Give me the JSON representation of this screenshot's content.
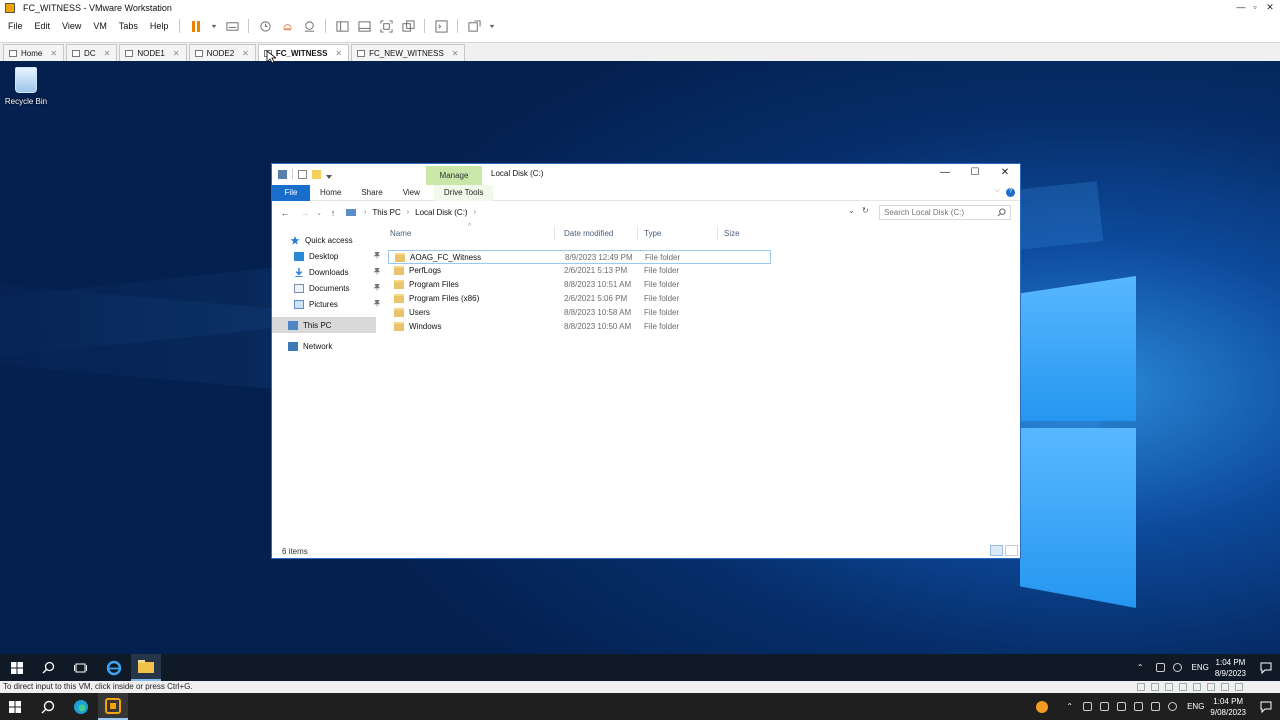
{
  "host_window": {
    "title": "FC_WITNESS - VMware Workstation",
    "menu": [
      "File",
      "Edit",
      "View",
      "VM",
      "Tabs",
      "Help"
    ],
    "window_controls": [
      "—",
      "▫",
      "✕"
    ]
  },
  "vm_tabs": [
    {
      "label": "Home",
      "active": false
    },
    {
      "label": "DC",
      "active": false
    },
    {
      "label": "NODE1",
      "active": false
    },
    {
      "label": "NODE2",
      "active": false
    },
    {
      "label": "FC_WITNESS",
      "active": true
    },
    {
      "label": "FC_NEW_WITNESS",
      "active": false
    }
  ],
  "desktop": {
    "recycle_bin_label": "Recycle Bin"
  },
  "explorer": {
    "manage_tab": "Manage",
    "window_title": "Local Disk (C:)",
    "ribbon_tabs": [
      "File",
      "Home",
      "Share",
      "View",
      "Drive Tools"
    ],
    "breadcrumb": [
      "This PC",
      "Local Disk (C:)"
    ],
    "search_placeholder": "Search Local Disk (C:)",
    "nav": {
      "quick_access": "Quick access",
      "pinned": [
        "Desktop",
        "Downloads",
        "Documents",
        "Pictures"
      ],
      "this_pc": "This PC",
      "network": "Network"
    },
    "columns": [
      "Name",
      "Date modified",
      "Type",
      "Size"
    ],
    "files": [
      {
        "name": "AOAG_FC_Witness",
        "date": "8/9/2023 12:49 PM",
        "type": "File folder",
        "size": ""
      },
      {
        "name": "PerfLogs",
        "date": "2/6/2021 5:13 PM",
        "type": "File folder",
        "size": ""
      },
      {
        "name": "Program Files",
        "date": "8/8/2023 10:51 AM",
        "type": "File folder",
        "size": ""
      },
      {
        "name": "Program Files (x86)",
        "date": "2/6/2021 5:06 PM",
        "type": "File folder",
        "size": ""
      },
      {
        "name": "Users",
        "date": "8/8/2023 10:58 AM",
        "type": "File folder",
        "size": ""
      },
      {
        "name": "Windows",
        "date": "8/8/2023 10:50 AM",
        "type": "File folder",
        "size": ""
      }
    ],
    "status": "6 items"
  },
  "guest_taskbar": {
    "language": "ENG",
    "time": "1:04 PM",
    "date": "8/9/2023"
  },
  "vm_status_text": "To direct input to this VM, click inside or press Ctrl+G.",
  "host_taskbar": {
    "language": "ENG",
    "time": "1:04 PM",
    "date": "9/08/2023"
  },
  "colors": {
    "accent": "#1a6ecb",
    "manage_tab": "#c8e7a8",
    "pause": "#f08000",
    "folder": "#e9c46a"
  }
}
